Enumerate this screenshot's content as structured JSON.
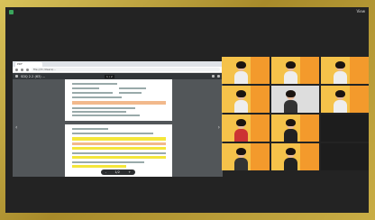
{
  "window": {
    "view_label": "View"
  },
  "browser": {
    "tab_label": "PDF",
    "address": "file:///C:/Users/...",
    "pdf_title": "SDQ 2.2 (63) ...",
    "page_indicator": "1 / 2",
    "zoom_controls": [
      "-",
      "1/2",
      "+"
    ]
  },
  "participants": [
    {
      "name": "",
      "tile": "video"
    },
    {
      "name": "",
      "tile": "video"
    },
    {
      "name": "",
      "tile": "video"
    },
    {
      "name": "",
      "tile": "video"
    },
    {
      "name": "",
      "tile": "video"
    },
    {
      "name": "",
      "tile": "video"
    },
    {
      "name": "",
      "tile": "video"
    },
    {
      "name": "",
      "tile": "video"
    },
    {
      "name": "",
      "tile": "dark"
    },
    {
      "name": "",
      "tile": "video"
    },
    {
      "name": "",
      "tile": "video"
    },
    {
      "name": "",
      "tile": "dark"
    }
  ],
  "colors": {
    "frame": "#c9ad45",
    "screen": "#232323",
    "tile_yellow": "#f5c24a",
    "tile_orange": "#f39a2c"
  }
}
